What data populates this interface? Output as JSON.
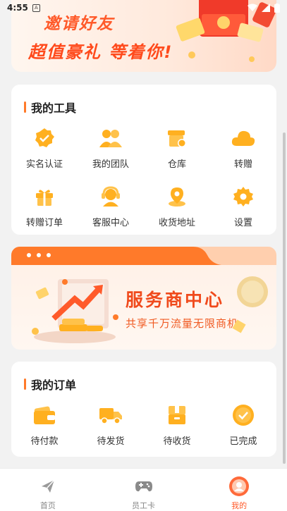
{
  "status_bar": {
    "time": "4:55",
    "notification_letter": "A"
  },
  "invite_banner": {
    "line1": "邀请好友",
    "line2": "超值豪礼 等着你!"
  },
  "tools": {
    "title": "我的工具",
    "items": [
      {
        "label": "实名认证",
        "icon": "verified-badge-icon"
      },
      {
        "label": "我的团队",
        "icon": "team-icon"
      },
      {
        "label": "仓库",
        "icon": "warehouse-icon"
      },
      {
        "label": "转赠",
        "icon": "cloud-icon"
      },
      {
        "label": "转赠订单",
        "icon": "gift-icon"
      },
      {
        "label": "客服中心",
        "icon": "headset-icon"
      },
      {
        "label": "收货地址",
        "icon": "location-icon"
      },
      {
        "label": "设置",
        "icon": "gear-icon"
      }
    ]
  },
  "service_banner": {
    "title": "服务商中心",
    "subtitle": "共享千万流量无限商机"
  },
  "orders": {
    "title": "我的订单",
    "items": [
      {
        "label": "待付款",
        "icon": "wallet-icon"
      },
      {
        "label": "待发货",
        "icon": "truck-icon"
      },
      {
        "label": "待收货",
        "icon": "package-icon"
      },
      {
        "label": "已完成",
        "icon": "check-circle-icon"
      }
    ]
  },
  "bottom_nav": [
    {
      "label": "首页",
      "icon": "paper-plane-icon"
    },
    {
      "label": "员工卡",
      "icon": "gamepad-icon"
    },
    {
      "label": "我的",
      "icon": "profile-icon",
      "active": true
    }
  ],
  "colors": {
    "accent": "#ff7a2a",
    "title_red": "#f04a1c",
    "icon_orange": "#ffb020"
  }
}
